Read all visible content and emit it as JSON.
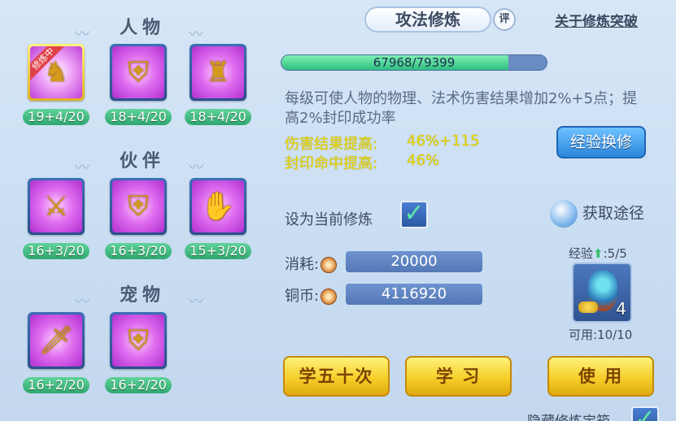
{
  "left_panel": {
    "sections": [
      {
        "title": "人物",
        "items": [
          {
            "level": "19+4/20",
            "badge": "修炼中",
            "active": true,
            "icon": "warrior-icon"
          },
          {
            "level": "18+4/20",
            "icon": "shield-warrior-icon"
          },
          {
            "level": "18+4/20",
            "icon": "armored-warrior-icon"
          }
        ]
      },
      {
        "title": "伙伴",
        "items": [
          {
            "level": "16+3/20",
            "icon": "tiger-sword-icon"
          },
          {
            "level": "16+3/20",
            "icon": "tiger-shield-icon"
          },
          {
            "level": "15+3/20",
            "icon": "tiger-hand-icon"
          }
        ]
      },
      {
        "title": "宠物",
        "items": [
          {
            "level": "16+2/20",
            "icon": "cat-sword-icon"
          },
          {
            "level": "16+2/20",
            "icon": "cat-shield-icon"
          }
        ]
      }
    ]
  },
  "header": {
    "title": "攻法修炼",
    "rate_label": "评",
    "about_link": "关于修炼突破"
  },
  "progress": {
    "text": "67968/79399",
    "current": 67968,
    "max": 79399
  },
  "description": "每级可使人物的物理、法术伤害结果增加2%+5点；提高2%封印成功率",
  "stats": [
    {
      "label": "伤害结果提高:",
      "value": "46%+115"
    },
    {
      "label": "封印命中提高:",
      "value": "46%"
    }
  ],
  "exchange_button": "经验换修",
  "set_current": {
    "label": "设为当前修炼",
    "checked": true
  },
  "acquire_link": "获取途径",
  "cost": {
    "label": "消耗:",
    "value": "20000"
  },
  "copper": {
    "label": "铜币:",
    "value": "4116920"
  },
  "experience": {
    "label": "经验",
    "value": ":5/5"
  },
  "item": {
    "count": "4",
    "available": "可用:10/10"
  },
  "buttons": {
    "learn_fifty": "学五十次",
    "learn": "学 习",
    "use": "使 用"
  },
  "hide_option": {
    "label": "隐藏修炼宝箱",
    "checked": true
  },
  "colors": {
    "background": "#cfe1f4",
    "level_green": "#3fb87c",
    "stat_yellow": "#e8d80a",
    "gold_button": "#f5cf2a",
    "blue_button": "#2a86dc"
  }
}
